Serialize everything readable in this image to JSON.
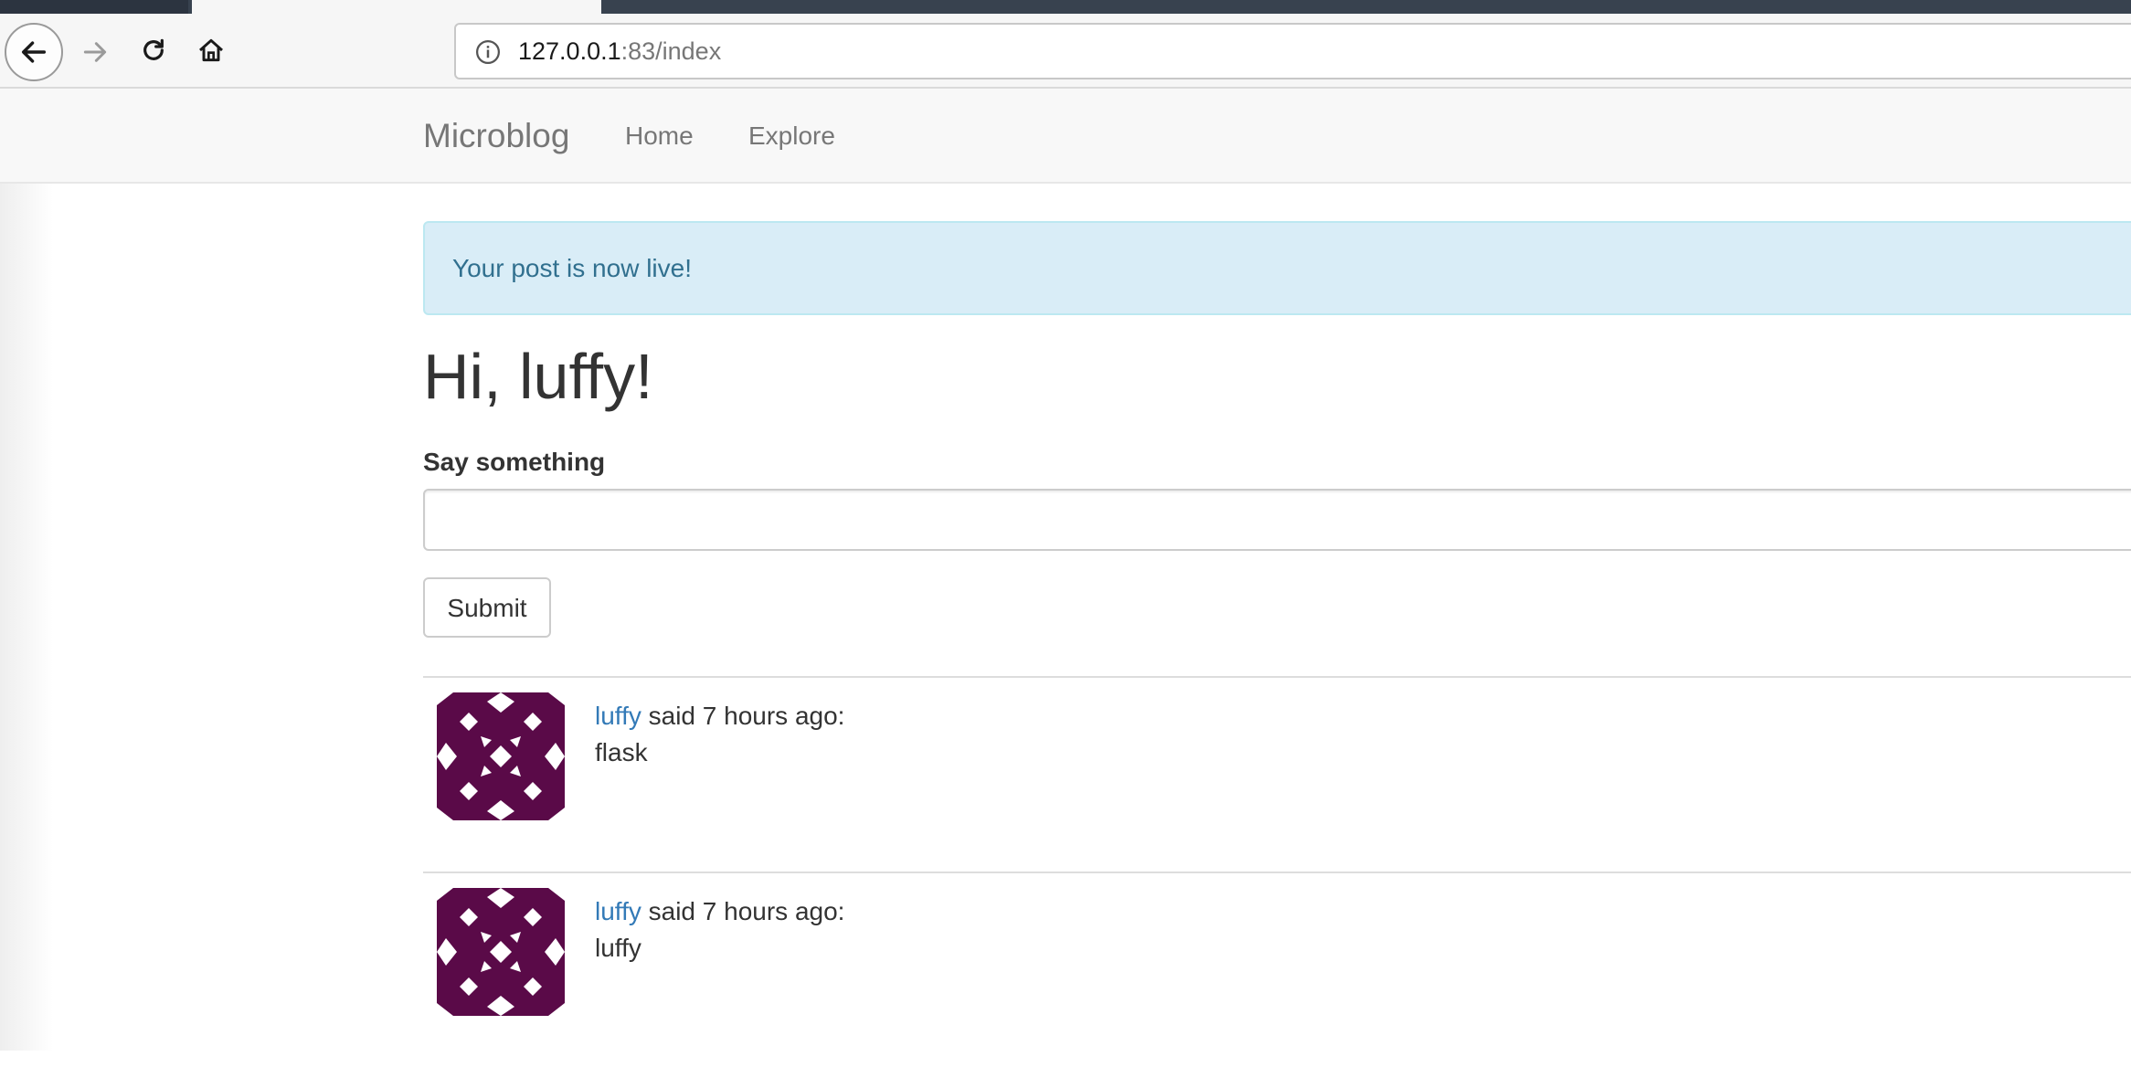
{
  "browser": {
    "url_host": "127.0.0.1",
    "url_rest": ":83/index"
  },
  "navbar": {
    "brand": "Microblog",
    "links": [
      {
        "label": "Home"
      },
      {
        "label": "Explore"
      }
    ]
  },
  "flash": {
    "message": "Your post is now live!"
  },
  "main": {
    "greeting": "Hi, luffy!",
    "form": {
      "label": "Say something",
      "input_value": "",
      "submit_label": "Submit"
    }
  },
  "posts": [
    {
      "author": "luffy",
      "meta": " said 7 hours ago:",
      "body": "flask"
    },
    {
      "author": "luffy",
      "meta": " said 7 hours ago:",
      "body": "luffy"
    }
  ],
  "colors": {
    "avatar_fg": "#5a0a48",
    "link": "#337ab7",
    "alert_bg": "#d9edf7"
  }
}
